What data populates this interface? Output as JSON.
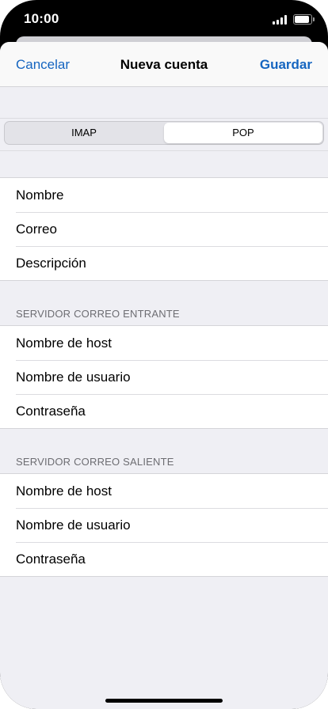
{
  "status_bar": {
    "time": "10:00",
    "signal_icon": "cellular-signal-icon",
    "battery_icon": "battery-icon",
    "battery_level": 0.9
  },
  "nav": {
    "cancel_label": "Cancelar",
    "title": "Nueva cuenta",
    "save_label": "Guardar",
    "accent_color": "#1565c0"
  },
  "segmented": {
    "options": [
      "IMAP",
      "POP"
    ],
    "selected": "POP"
  },
  "account_fields": [
    {
      "label": "Nombre"
    },
    {
      "label": "Correo"
    },
    {
      "label": "Descripción"
    }
  ],
  "incoming": {
    "header": "SERVIDOR CORREO ENTRANTE",
    "fields": [
      {
        "label": "Nombre de host"
      },
      {
        "label": "Nombre de usuario"
      },
      {
        "label": "Contraseña"
      }
    ]
  },
  "outgoing": {
    "header": "SERVIDOR CORREO SALIENTE",
    "fields": [
      {
        "label": "Nombre de host"
      },
      {
        "label": "Nombre de usuario"
      },
      {
        "label": "Contraseña"
      }
    ]
  }
}
